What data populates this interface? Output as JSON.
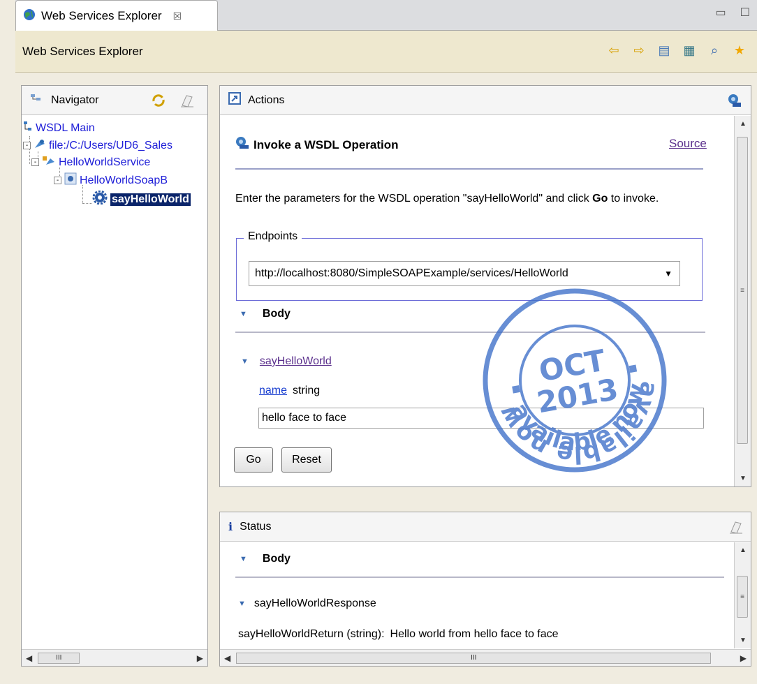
{
  "tab": {
    "title": "Web Services Explorer",
    "close": "☒"
  },
  "window_buttons": {
    "minimize": "▭",
    "maximize": "☐"
  },
  "titlebar": {
    "title": "Web Services Explorer"
  },
  "toolbar": {
    "back": "⇦",
    "forward": "⇨",
    "icon3": "▤",
    "icon4": "▦",
    "icon5": "⌕",
    "favorite": "★"
  },
  "navigator": {
    "title": "Navigator",
    "tree": {
      "root": "WSDL Main",
      "file": "file:/C:/Users/UD6_Sales",
      "service": "HelloWorldService",
      "binding": "HelloWorldSoapB",
      "operation": "sayHelloWorld"
    },
    "scroll_thumb": "III"
  },
  "actions": {
    "title": "Actions",
    "heading": "Invoke a WSDL Operation",
    "source_link": "Source",
    "instruction_part1": "Enter the parameters for the WSDL operation \"sayHelloWorld\" and click ",
    "instruction_bold": "Go",
    "instruction_part2": " to invoke.",
    "endpoints_label": "Endpoints",
    "endpoint_value": "http://localhost:8080/SimpleSOAPExample/services/HelloWorld",
    "body_label": "Body",
    "operation_link": "sayHelloWorld",
    "param_name": "name",
    "param_type": "string",
    "param_value": "hello face to face",
    "go_button": "Go",
    "reset_button": "Reset",
    "scroll_thumb": "≡"
  },
  "stamp": {
    "top": "available now",
    "month": "OCT",
    "year": "2013",
    "bottom": "available now"
  },
  "status": {
    "title": "Status",
    "body_label": "Body",
    "response_label": "sayHelloWorldResponse",
    "return_label": "sayHelloWorldReturn (string):",
    "return_value": "Hello world from hello face to face",
    "scroll_thumb": "III"
  }
}
